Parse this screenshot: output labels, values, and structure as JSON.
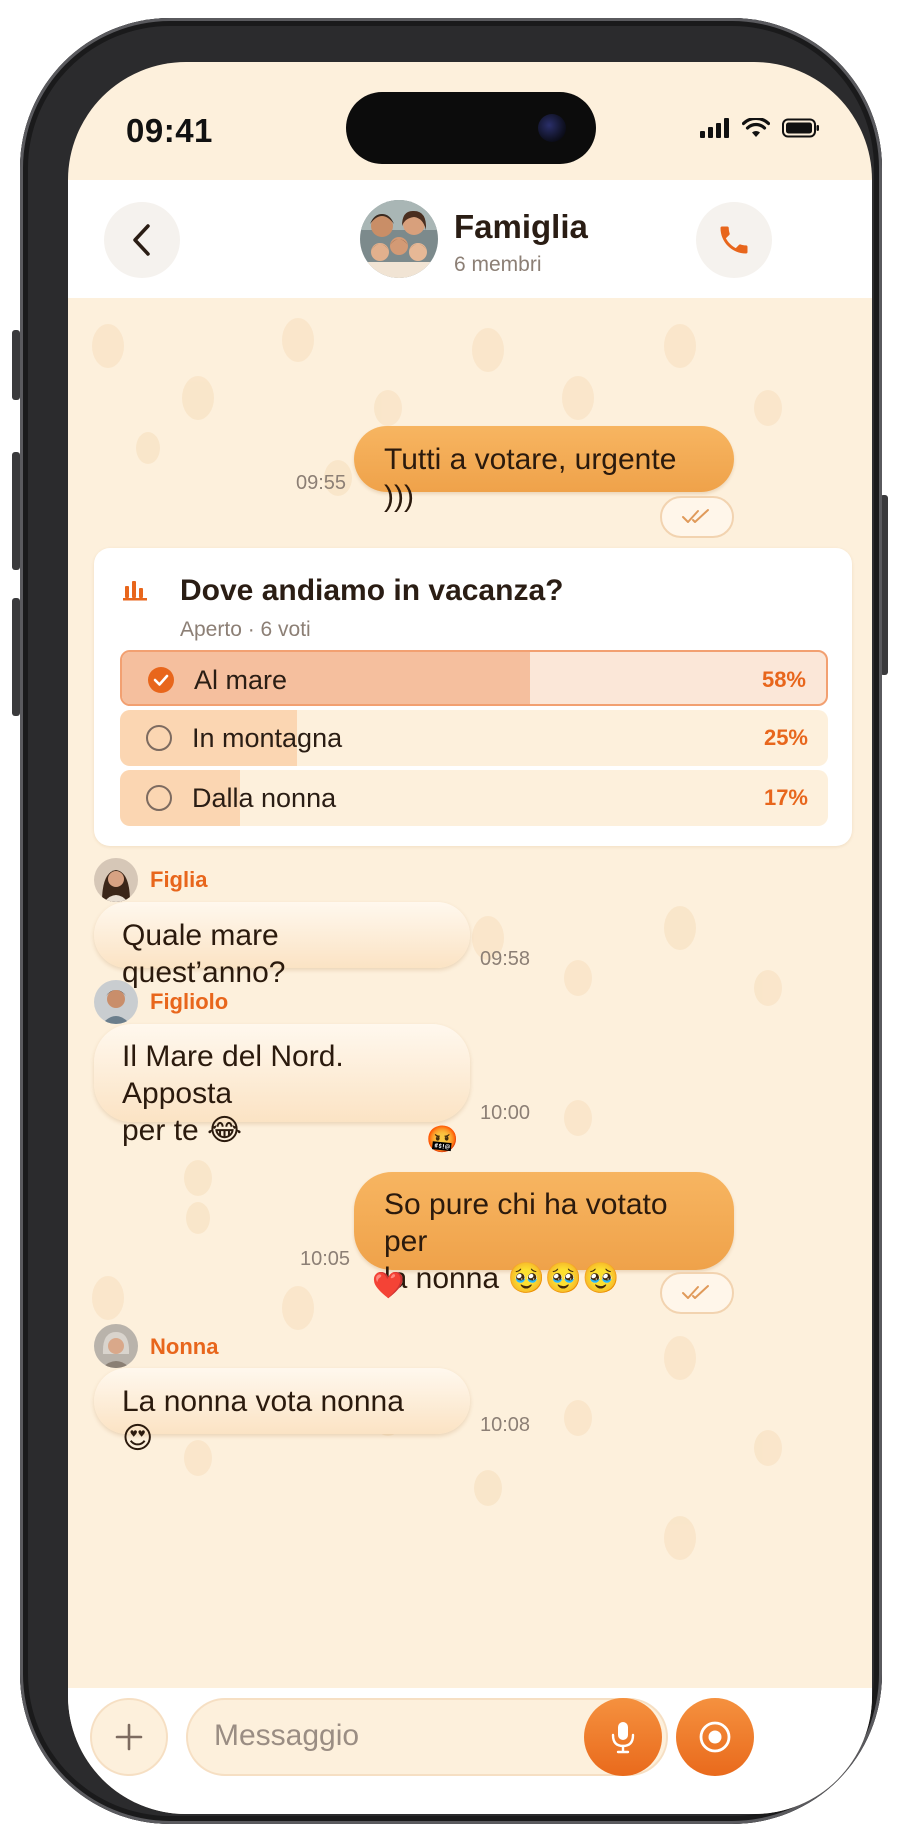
{
  "status_bar": {
    "time": "09:41"
  },
  "header": {
    "back_icon": "chevron-left-icon",
    "title": "Famiglia",
    "subtitle": "6 membri",
    "call_icon": "phone-icon",
    "accent": "#e8661c"
  },
  "messages": [
    {
      "type": "outgoing",
      "text": "Tutti a votare, urgente )))",
      "time": "09:55",
      "status_icon": "double-check-icon"
    },
    {
      "type": "poll",
      "poll": {
        "icon": "bar-chart-icon",
        "question": "Dove andiamo in vacanza?",
        "meta": "Aperto · 6 voti",
        "options": [
          {
            "label": "Al mare",
            "percent": "58%",
            "fraction": 0.58,
            "selected": true
          },
          {
            "label": "In montagna",
            "percent": "25%",
            "fraction": 0.25,
            "selected": false
          },
          {
            "label": "Dalla nonna",
            "percent": "17%",
            "fraction": 0.17,
            "selected": false
          }
        ]
      }
    },
    {
      "type": "incoming",
      "sender": "Figlia",
      "text": "Quale mare quest’anno?",
      "time": "09:58"
    },
    {
      "type": "incoming",
      "sender": "Figliolo",
      "text_line1": "Il Mare del Nord. Apposta",
      "text_line2": "per te 😂",
      "time": "10:00",
      "reaction": "🤬"
    },
    {
      "type": "outgoing",
      "text_line1": "So pure chi ha votato per",
      "text_line2": "la nonna 🥹🥹🥹",
      "time": "10:05",
      "reaction": "❤️",
      "status_icon": "double-check-icon"
    },
    {
      "type": "incoming",
      "sender": "Nonna",
      "text": "La nonna vota nonna 😍",
      "time": "10:08"
    }
  ],
  "composer": {
    "placeholder": "Messaggio",
    "plus_icon": "plus-icon",
    "mic_icon": "microphone-icon",
    "camera_icon": "video-circle-icon"
  }
}
